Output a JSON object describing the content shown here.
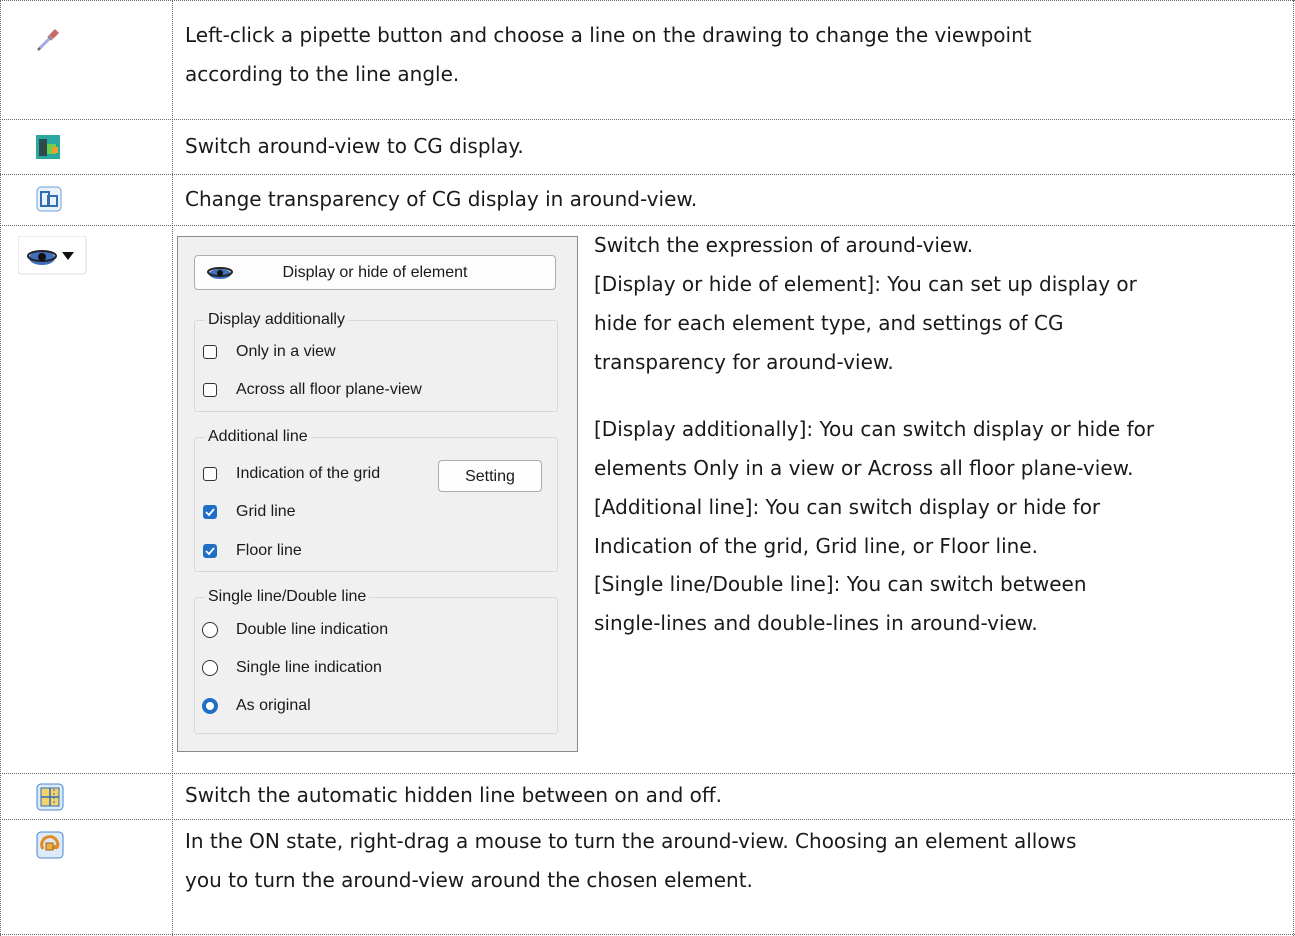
{
  "rows": [
    {
      "icon": "pipette-icon",
      "text": [
        "Left-click a pipette button and choose a line on the drawing to change the viewpoint",
        "according to the line angle."
      ]
    },
    {
      "icon": "cg-display-icon",
      "text": [
        "Switch around-view to CG display."
      ]
    },
    {
      "icon": "cg-transparency-icon",
      "text": [
        "Change transparency of CG display in around-view."
      ]
    },
    {
      "icon": "eye-dropdown-icon",
      "text": []
    },
    {
      "icon": "hidden-line-icon",
      "text": [
        "Switch the automatic hidden line between on and off."
      ]
    },
    {
      "icon": "turn-view-icon",
      "text": [
        "In the ON state, right-drag a mouse to turn the around-view. Choosing an element allows",
        "you to turn the around-view around the chosen element."
      ]
    }
  ],
  "panel": {
    "top_button": "Display or hide of element",
    "group1": {
      "title": "Display additionally",
      "options": [
        {
          "label": "Only in a view",
          "checked": false
        },
        {
          "label": "Across all floor plane-view",
          "checked": false
        }
      ]
    },
    "group2": {
      "title": "Additional line",
      "options": [
        {
          "label": "Indication of the grid",
          "checked": false
        },
        {
          "label": "Grid line",
          "checked": true
        },
        {
          "label": "Floor line",
          "checked": true
        }
      ],
      "setting_button": "Setting"
    },
    "group3": {
      "title": "Single line/Double line",
      "options": [
        {
          "label": "Double line indication",
          "selected": false
        },
        {
          "label": "Single line indication",
          "selected": false
        },
        {
          "label": "As original",
          "selected": true
        }
      ]
    }
  },
  "eye_description": [
    "Switch the expression of around-view.",
    "[Display or hide of element]: You can set up display or",
    "hide for each element type, and settings of CG",
    "transparency for around-view.",
    "[Display additionally]: You can switch display or hide for",
    "elements Only in a view or Across all floor plane-view.",
    "[Additional line]: You can switch display or hide for",
    "Indication of the grid, Grid line, or Floor line.",
    "[Single line/Double line]: You can switch between",
    "single-lines and double-lines in around-view."
  ],
  "colors": {
    "accent": "#1f6fc5",
    "border": "#6a6a6a",
    "panel_bg": "#f0f0f0"
  }
}
